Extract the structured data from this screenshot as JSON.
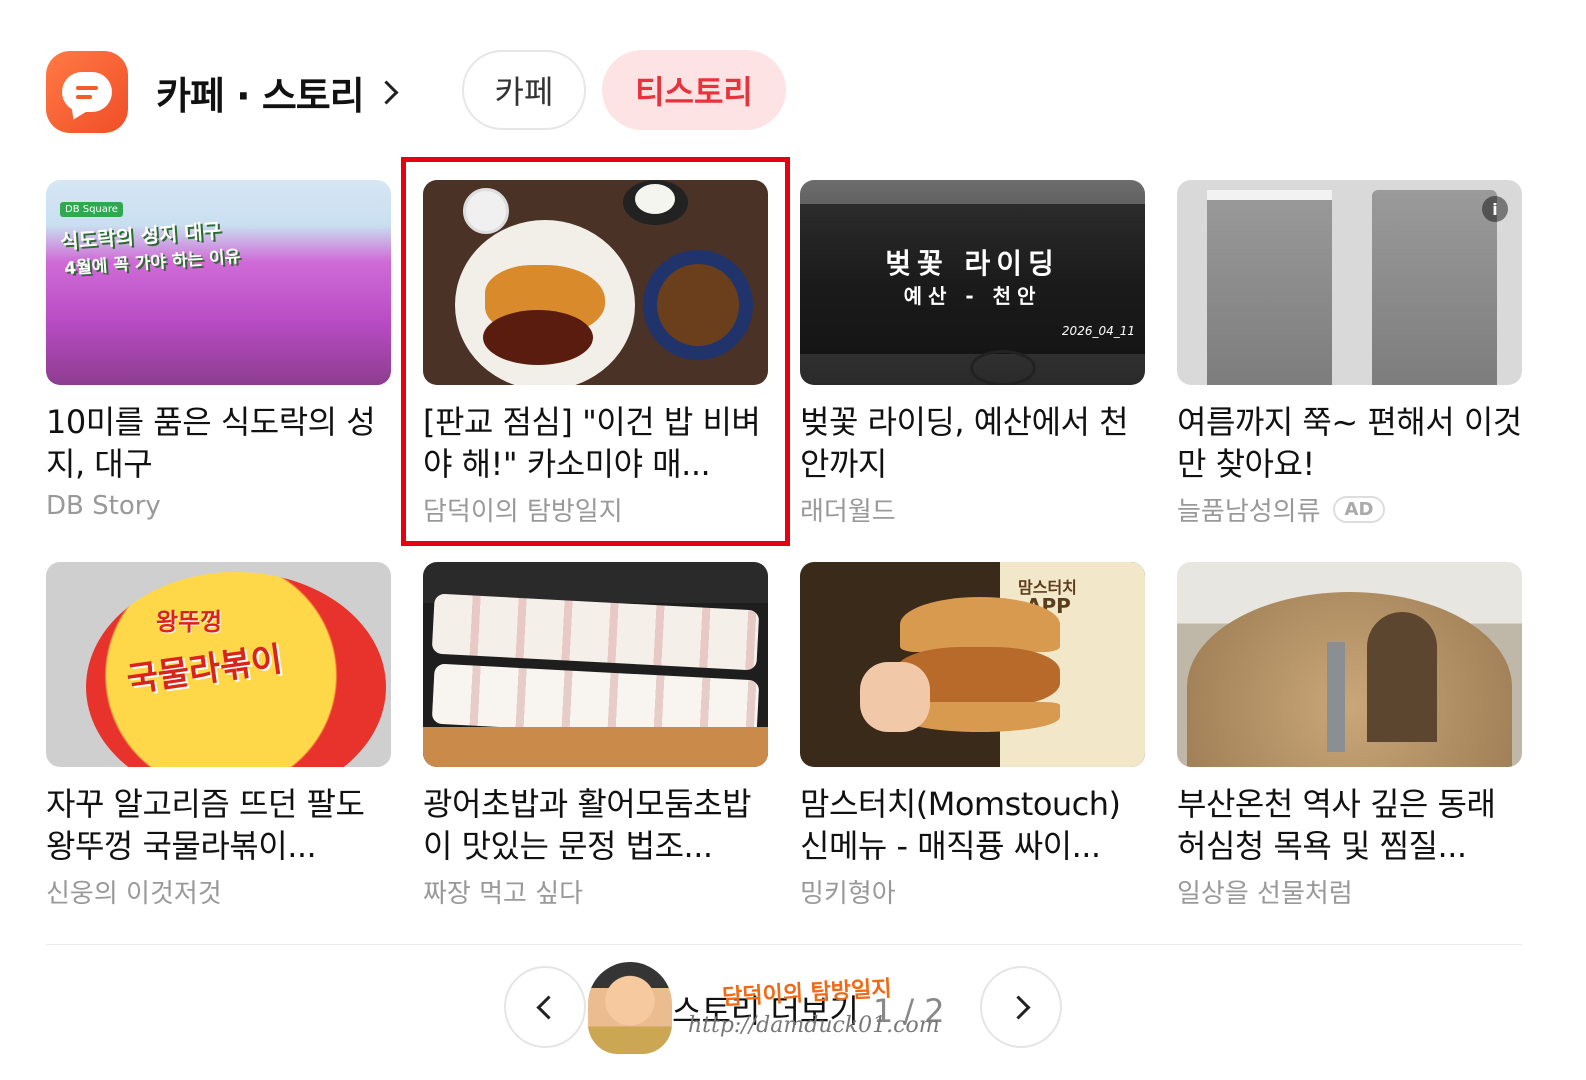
{
  "header": {
    "title": "카페 · 스토리",
    "tabs": [
      {
        "label": "카페",
        "active": false
      },
      {
        "label": "티스토리",
        "active": true
      }
    ],
    "accent_color": "#e8333c"
  },
  "cards": [
    {
      "title": "10미를 품은 식도락의 성지, 대구",
      "source": "DB Story",
      "ad": false,
      "thumb_text": {
        "tag": "DB Square",
        "line1": "식도락의 성지 대구",
        "line2": "4월에 꼭 가야 하는 이유"
      }
    },
    {
      "title": "[판교 점심] \"이건 밥 비벼야 해!\" 카소미야 매...",
      "source": "담덕이의 탐방일지",
      "ad": false,
      "highlighted": true
    },
    {
      "title": "벚꽃 라이딩, 예산에서 천안까지",
      "source": "래더월드",
      "ad": false,
      "thumb_text": {
        "line1": "벚꽃 라이딩",
        "line2": "예산 - 천안",
        "date": "2026_04_11"
      }
    },
    {
      "title": "여름까지 쭉~ 편해서 이것만 찾아요!",
      "source": "늘품남성의류",
      "ad": true,
      "ad_label": "AD"
    },
    {
      "title": "자꾸 알고리즘 뜨던 팔도 왕뚜껑 국물라볶이...",
      "source": "신웅의 이것저것",
      "ad": false,
      "thumb_text": {
        "line1": "왕뚜껑",
        "line2": "국물라볶이"
      }
    },
    {
      "title": "광어초밥과 활어모둠초밥이 맛있는 문정 법조...",
      "source": "짜장 먹고 싶다",
      "ad": false
    },
    {
      "title": "맘스터치(Momstouch) 신메뉴 - 매직퓽 싸이...",
      "source": "밍키형아",
      "ad": false,
      "thumb_text": {
        "line1": "맘스터치",
        "line2": "APP"
      }
    },
    {
      "title": "부산온천 역사 깊은 동래허심청 목욕 및 찜질...",
      "source": "일상을 선물처럼",
      "ad": false
    }
  ],
  "pager": {
    "label": "스토리 더보기",
    "current": "1",
    "total": "2",
    "count_text": "1 / 2"
  },
  "watermark": {
    "name": "담덕이의 탐방일지",
    "url": "http://damduck01.com"
  }
}
